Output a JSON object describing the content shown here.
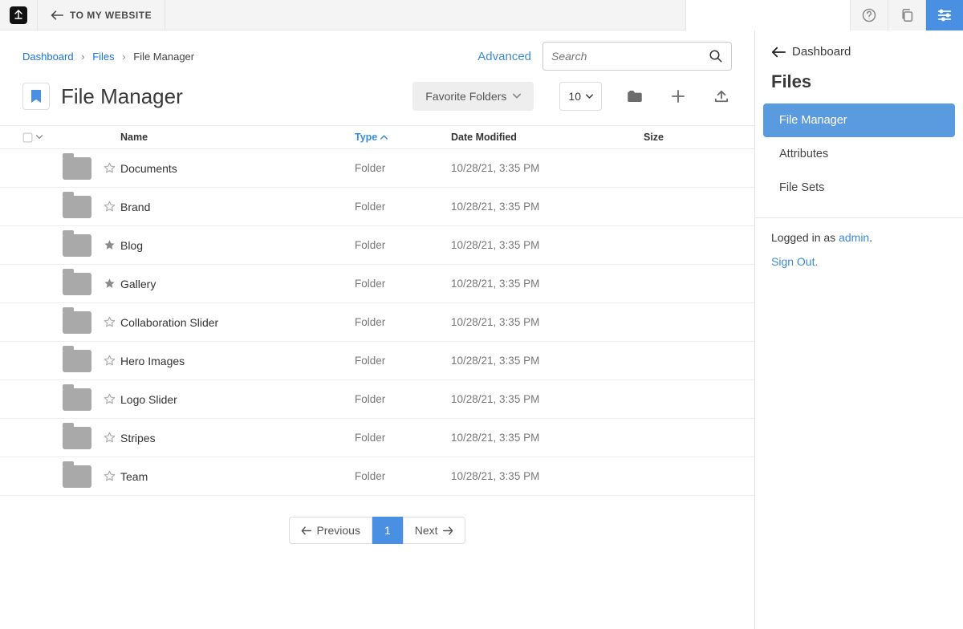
{
  "topbar": {
    "to_site": "TO MY WEBSITE",
    "search_placeholder": ""
  },
  "breadcrumbs": {
    "items": [
      "Dashboard",
      "Files",
      "File Manager"
    ]
  },
  "toolbar": {
    "advanced": "Advanced",
    "search_placeholder": "Search",
    "page_title": "File Manager",
    "favorite_folders": "Favorite Folders",
    "per_page": "10"
  },
  "table": {
    "headers": {
      "name": "Name",
      "type": "Type",
      "date": "Date Modified",
      "size": "Size"
    },
    "rows": [
      {
        "name": "Documents",
        "type": "Folder",
        "date": "10/28/21, 3:35 PM",
        "size": "",
        "fav": false
      },
      {
        "name": "Brand",
        "type": "Folder",
        "date": "10/28/21, 3:35 PM",
        "size": "",
        "fav": false
      },
      {
        "name": "Blog",
        "type": "Folder",
        "date": "10/28/21, 3:35 PM",
        "size": "",
        "fav": true
      },
      {
        "name": "Gallery",
        "type": "Folder",
        "date": "10/28/21, 3:35 PM",
        "size": "",
        "fav": true
      },
      {
        "name": "Collaboration Slider",
        "type": "Folder",
        "date": "10/28/21, 3:35 PM",
        "size": "",
        "fav": false
      },
      {
        "name": "Hero Images",
        "type": "Folder",
        "date": "10/28/21, 3:35 PM",
        "size": "",
        "fav": false
      },
      {
        "name": "Logo Slider",
        "type": "Folder",
        "date": "10/28/21, 3:35 PM",
        "size": "",
        "fav": false
      },
      {
        "name": "Stripes",
        "type": "Folder",
        "date": "10/28/21, 3:35 PM",
        "size": "",
        "fav": false
      },
      {
        "name": "Team",
        "type": "Folder",
        "date": "10/28/21, 3:35 PM",
        "size": "",
        "fav": false
      }
    ]
  },
  "pager": {
    "prev": "Previous",
    "next": "Next",
    "current": "1"
  },
  "side": {
    "back": "Dashboard",
    "title": "Files",
    "items": [
      {
        "label": "File Manager",
        "active": true
      },
      {
        "label": "Attributes",
        "active": false
      },
      {
        "label": "File Sets",
        "active": false
      }
    ],
    "logged_in_prefix": "Logged in as ",
    "user": "admin",
    "period": ".",
    "sign_out": "Sign Out."
  }
}
